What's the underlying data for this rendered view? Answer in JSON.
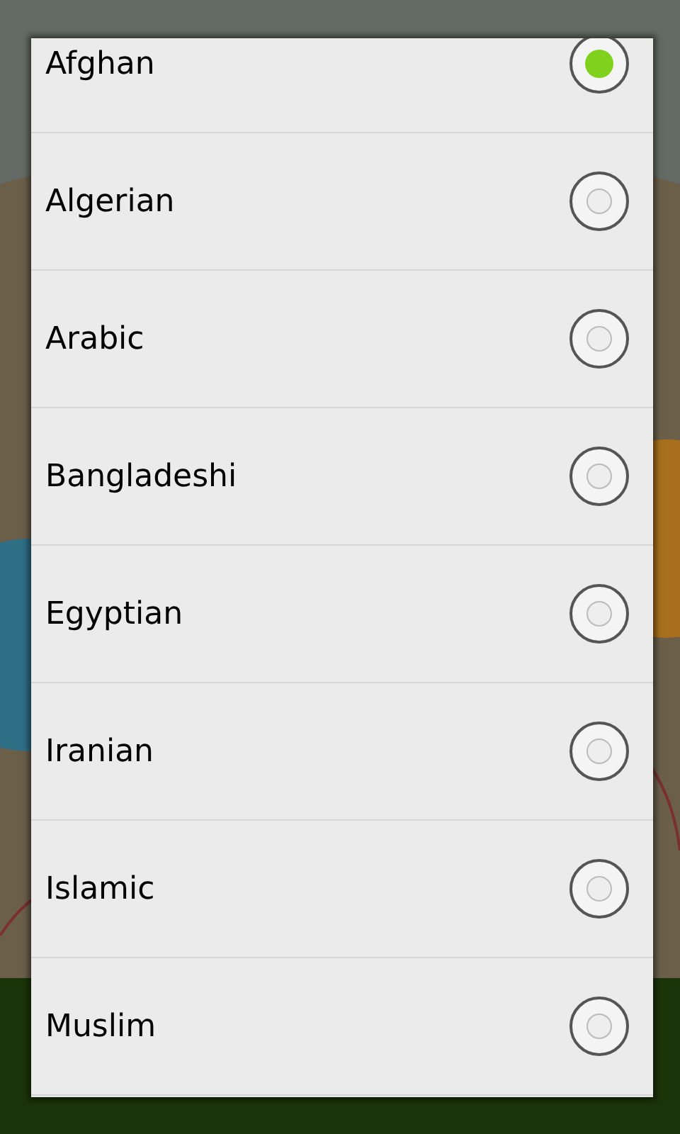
{
  "options": [
    {
      "label": "Afghan",
      "selected": true
    },
    {
      "label": "Algerian",
      "selected": false
    },
    {
      "label": "Arabic",
      "selected": false
    },
    {
      "label": "Bangladeshi",
      "selected": false
    },
    {
      "label": "Egyptian",
      "selected": false
    },
    {
      "label": "Iranian",
      "selected": false
    },
    {
      "label": "Islamic",
      "selected": false
    },
    {
      "label": "Muslim",
      "selected": false
    }
  ]
}
